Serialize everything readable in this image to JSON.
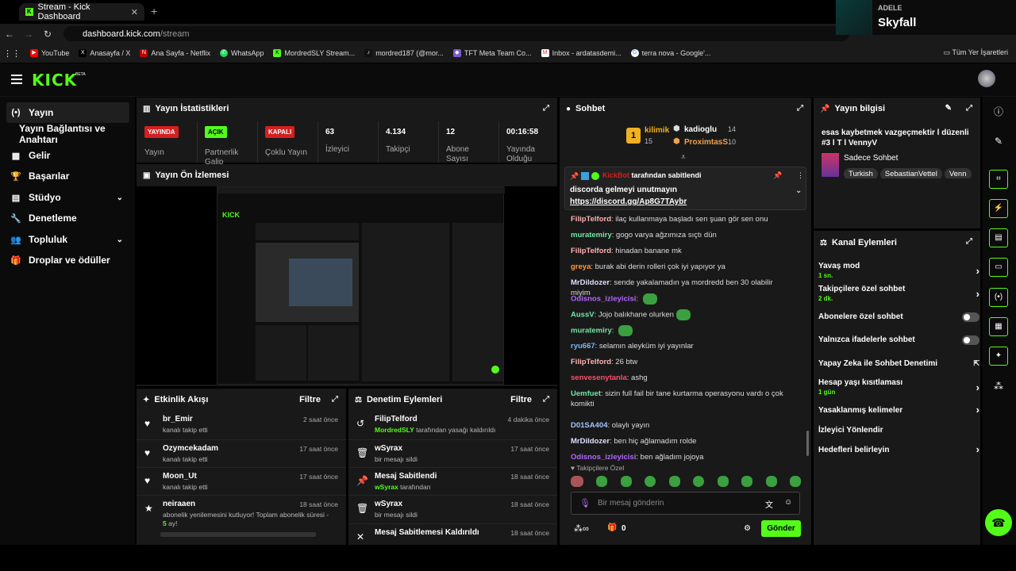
{
  "browser": {
    "tab_title": "Stream - Kick Dashboard",
    "url_domain": "dashboard.kick.com",
    "url_path": "/stream",
    "bookmarks": [
      "YouTube",
      "Anasayfa / X",
      "Ana Sayfa - Netflix",
      "WhatsApp",
      "MordredSLY Stream...",
      "mordred187 (@mor...",
      "TFT Meta Team Co...",
      "Inbox - ardatasdemi...",
      "terra nova - Google'..."
    ],
    "all_bookmarks": "Tüm Yer İşaretleri"
  },
  "now_playing": {
    "artist": "ADELE",
    "title": "Skyfall"
  },
  "brand": {
    "logo": "KICK",
    "beta": "BETA",
    "accent": "#53fc18"
  },
  "sidebar": {
    "items": [
      {
        "label": "Yayın",
        "icon": "(•)"
      },
      {
        "label": "Yayın Bağlantısı ve Anahtarı",
        "icon": ""
      },
      {
        "label": "Gelir",
        "icon": "▦"
      },
      {
        "label": "Başarılar",
        "icon": "🏆"
      },
      {
        "label": "Stüdyo",
        "icon": "▤"
      },
      {
        "label": "Denetleme",
        "icon": "🔧"
      },
      {
        "label": "Topluluk",
        "icon": "👥"
      },
      {
        "label": "Droplar ve ödüller",
        "icon": "🎁"
      }
    ]
  },
  "stats_panel": {
    "title": "Yayın İstatistikleri",
    "items": [
      {
        "value": "YAYINDA",
        "label": "Yayın",
        "badge": "red"
      },
      {
        "value": "AÇIK",
        "label": "Partnerlik Galip",
        "badge": "green"
      },
      {
        "value": "KAPALI",
        "label": "Çoklu Yayın",
        "badge": "red"
      },
      {
        "value": "63",
        "label": "İzleyici",
        "badge": ""
      },
      {
        "value": "4.134",
        "label": "Takipçi",
        "badge": ""
      },
      {
        "value": "12",
        "label": "Abone Sayısı",
        "badge": ""
      },
      {
        "value": "00:16:58",
        "label": "Yayında Olduğu",
        "badge": ""
      }
    ]
  },
  "preview_panel": {
    "title": "Yayın Ön İzlemesi"
  },
  "activity_panel": {
    "title": "Etkinlik Akışı",
    "filter": "Filtre",
    "items": [
      {
        "name": "br_Emir",
        "sub": "kanalı takip etti",
        "time": "2 saat önce",
        "icon": "♥"
      },
      {
        "name": "Ozymcekadam",
        "sub": "kanalı takip etti",
        "time": "17 saat önce",
        "icon": "♥"
      },
      {
        "name": "Moon_Ut",
        "sub": "kanalı takip etti",
        "time": "17 saat önce",
        "icon": "♥"
      },
      {
        "name": "neiraaen",
        "sub": "abonelik yenilemesini kutluyor! Toplam abonelik süresi -",
        "sub_highlight": "5",
        "sub_end": "ay!",
        "time": "18 saat önce",
        "icon": "★"
      }
    ]
  },
  "mod_panel": {
    "title": "Denetim Eylemleri",
    "filter": "Filtre",
    "items": [
      {
        "name": "FilipTelford",
        "sub_user": "MordredSLY",
        "sub": "tarafından yasağı kaldırıldı",
        "time": "4 dakika önce",
        "icon": "↺"
      },
      {
        "name": "wSyrax",
        "sub_user": "",
        "sub": "bir mesajı sildi",
        "time": "17 saat önce",
        "icon": "🗑"
      },
      {
        "name": "Mesaj Sabitlendi",
        "sub_user": "wSyrax",
        "sub": "tarafından",
        "time": "18 saat önce",
        "icon": "📌"
      },
      {
        "name": "wSyrax",
        "sub_user": "",
        "sub": "bir mesajı sildi",
        "time": "18 saat önce",
        "icon": "🗑"
      },
      {
        "name": "Mesaj Sabitlemesi Kaldırıldı",
        "sub_user": "",
        "sub": "",
        "time": "18 saat önce",
        "icon": "✕"
      }
    ]
  },
  "chat_panel": {
    "title": "Sohbet",
    "leaders": [
      {
        "rank": "1",
        "name": "kilimik",
        "count": "15"
      },
      {
        "name": "kadioglu",
        "count": "14"
      },
      {
        "name": "ProximtasS",
        "count": "10"
      }
    ],
    "pinned": {
      "by_user": "KickBot",
      "by_text": "tarafından sabitlendi",
      "message": "discorda gelmeyi unutmayın",
      "link": "https://discord.gg/Ap8G7TAybr"
    },
    "messages": [
      {
        "user": "FilipTelford",
        "color": "#ffb3b3",
        "text": "ilaç kullanmaya başladı sen şuan gör sen onu"
      },
      {
        "user": "muratemiry",
        "color": "#74e6a8",
        "text": "gogo varya ağzımıza sıçtı dün"
      },
      {
        "user": "FilipTelford",
        "color": "#ffb3b3",
        "text": "hinadan banane mk"
      },
      {
        "user": "greya",
        "color": "#ff9a3c",
        "text": "burak abi derin rolleri çok iyi yapıyor ya"
      },
      {
        "user": "MrDildozer",
        "color": "#e0e0ff",
        "text": "sende yakalamadın ya mordredd ben 30 olabilir miyim"
      },
      {
        "user": "Odisnos_izleyicisi",
        "color": "#b266ff",
        "text": "",
        "emote": true
      },
      {
        "user": "AussV",
        "color": "#74e6a8",
        "text": "Jojo balıkhane olurken",
        "emote": true
      },
      {
        "user": "muratemiry",
        "color": "#74e6a8",
        "text": "",
        "emote": true
      },
      {
        "user": "ryu667",
        "color": "#7ab8ff",
        "text": "selamın aleyküm iyi yayınlar"
      },
      {
        "user": "FilipTelford",
        "color": "#ffb3b3",
        "text": "26 btw"
      },
      {
        "user": "senvesenytanla",
        "color": "#ff4d6d",
        "text": "ashg"
      },
      {
        "user": "Uemfuet",
        "color": "#74e6a8",
        "text": "sizin full fail bir tane kurtarma operasyonu vardı o çok komikti"
      },
      {
        "user": "D01SA404",
        "color": "#a0c4ff",
        "text": "olaylı yayın"
      },
      {
        "user": "MrDildozer",
        "color": "#e0e0ff",
        "text": "ben hiç ağlamadım rolde"
      },
      {
        "user": "Odisnos_izleyicisi",
        "color": "#b266ff",
        "text": "ben ağladım jojoya"
      }
    ],
    "followers_only": "Takipçilere Özel",
    "input_placeholder": "Bir mesaj gönderin",
    "gift_count": "0",
    "send": "Gönder"
  },
  "info_panel": {
    "title": "Yayın bilgisi",
    "stream_title": "esas kaybetmek vazgeçmektir l düzenli #3 l T l VennyV",
    "category": "Sadece Sohbet",
    "tags": [
      "Turkish",
      "SebastianVettel",
      "Venn"
    ]
  },
  "channel_actions": {
    "title": "Kanal Eylemleri",
    "items": [
      {
        "label": "Yavaş mod",
        "sub": "1 sn.",
        "control": "arrow"
      },
      {
        "label": "Takipçilere özel sohbet",
        "sub": "2 dk.",
        "control": "arrow"
      },
      {
        "label": "Abonelere özel sohbet",
        "sub": "",
        "control": "toggle"
      },
      {
        "label": "Yalnızca ifadelerle sohbet",
        "sub": "",
        "control": "toggle"
      },
      {
        "label": "Yapay Zeka ile Sohbet Denetimi",
        "sub": "",
        "control": "ext"
      },
      {
        "label": "Hesap yaşı kısıtlaması",
        "sub": "1 gün",
        "control": "arrow"
      },
      {
        "label": "Yasaklanmış kelimeler",
        "sub": "",
        "control": "arrow"
      },
      {
        "label": "İzleyici Yönlendir",
        "sub": "",
        "control": "none"
      },
      {
        "label": "Hedefleri belirleyin",
        "sub": "",
        "control": "arrow"
      }
    ]
  },
  "icons": {
    "expand": "expand-icon",
    "edit": "pencil-icon",
    "info": "info-icon"
  }
}
